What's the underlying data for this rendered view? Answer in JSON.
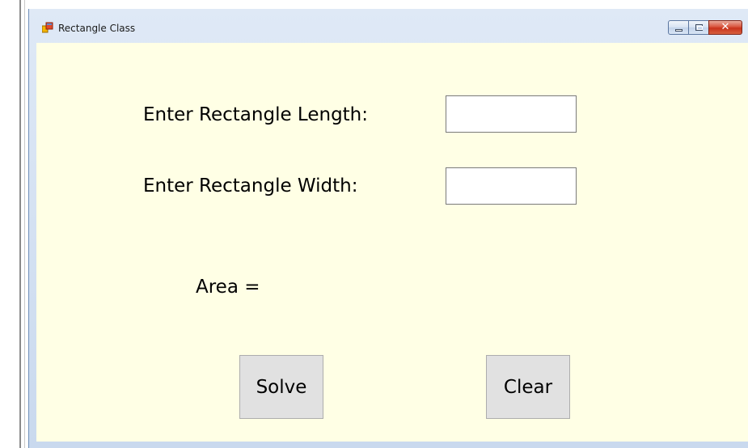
{
  "window": {
    "title": "Rectangle Class",
    "close_glyph": "✕"
  },
  "form": {
    "length_label": "Enter Rectangle Length:",
    "length_value": "",
    "width_label": "Enter Rectangle Width:",
    "width_value": "",
    "area_label": "Area ="
  },
  "buttons": {
    "solve_label": "Solve",
    "clear_label": "Clear"
  },
  "colors": {
    "client_background": "#ffffe5",
    "button_face": "#e1e1e1",
    "close_button": "#c8331c"
  },
  "icons": {
    "app": "form-window-icon",
    "minimize": "minimize-icon",
    "maximize": "maximize-icon",
    "close": "close-icon"
  }
}
